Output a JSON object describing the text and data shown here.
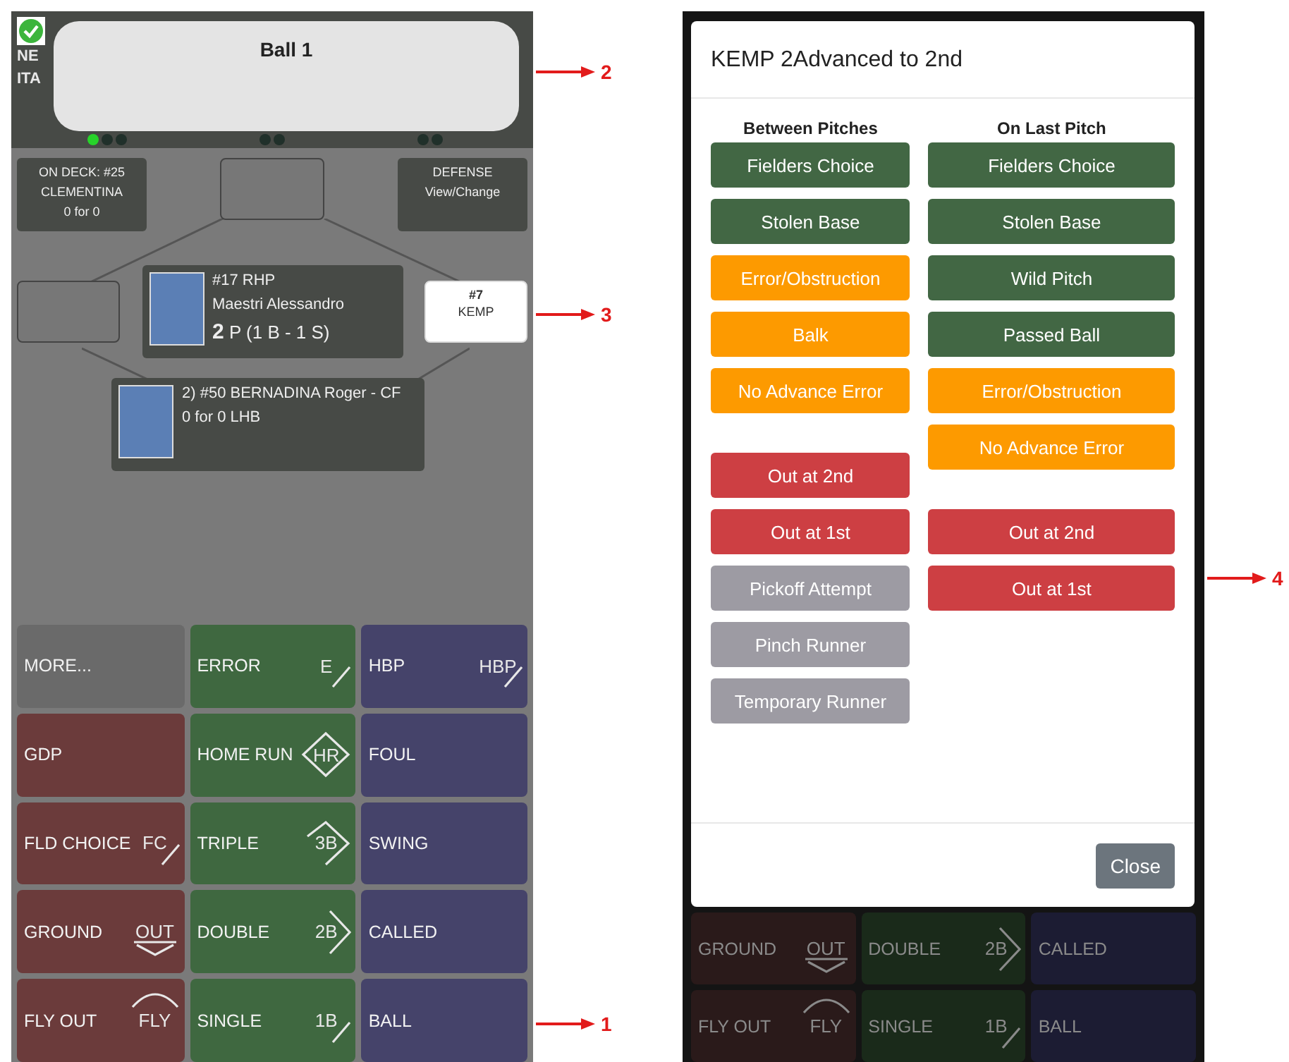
{
  "left_screen": {
    "scoreboard": {
      "saved": true,
      "teams": [
        "NE",
        "ITA"
      ],
      "balls": [
        {
          "lit": true
        },
        {
          "lit": false
        },
        {
          "lit": false
        }
      ],
      "strikes": [
        {
          "lit": false
        },
        {
          "lit": false
        }
      ],
      "outs": [
        {
          "lit": false
        },
        {
          "lit": false
        }
      ]
    },
    "toast": {
      "title": "Ball 1"
    },
    "field": {
      "on_deck": {
        "lines": [
          "ON DECK: #25",
          "CLEMENTINA",
          "0 for 0"
        ]
      },
      "defense": {
        "lines": [
          "DEFENSE",
          "View/Change"
        ]
      },
      "second_base": {
        "occupied": false
      },
      "third_base": {
        "occupied": false
      },
      "first_base": {
        "occupied": true,
        "number": "#7",
        "name": "KEMP"
      },
      "pitcher": {
        "line1": "#17 RHP",
        "name": "Maestri Alessandro",
        "pitch_count": "2",
        "pitch_detail": "P (1 B - 1 S)"
      },
      "batter": {
        "line1": "2) #50 BERNADINA Roger - CF",
        "line2": "0 for 0 LHB"
      }
    },
    "buttons": [
      {
        "label": "MORE...",
        "kind": "more"
      },
      {
        "label": "ERROR",
        "kind": "hit",
        "symbol": {
          "text": "E",
          "kind": "slash"
        }
      },
      {
        "label": "HBP",
        "kind": "pitch",
        "symbol": {
          "text": "HBP",
          "kind": "slash"
        }
      },
      {
        "label": "GDP",
        "kind": "out"
      },
      {
        "label": "HOME RUN",
        "kind": "hit",
        "symbol": {
          "text": "HR",
          "kind": "diamond"
        }
      },
      {
        "label": "FOUL",
        "kind": "pitch"
      },
      {
        "label": "FLD CHOICE",
        "kind": "out",
        "symbol": {
          "text": "FC",
          "kind": "slash"
        }
      },
      {
        "label": "TRIPLE",
        "kind": "hit",
        "symbol": {
          "text": "3B",
          "kind": "triple"
        }
      },
      {
        "label": "SWING",
        "kind": "pitch"
      },
      {
        "label": "GROUND",
        "kind": "out",
        "symbol": {
          "text": "OUT",
          "kind": "catch"
        }
      },
      {
        "label": "DOUBLE",
        "kind": "hit",
        "symbol": {
          "text": "2B",
          "kind": "chevron"
        }
      },
      {
        "label": "CALLED",
        "kind": "pitch"
      },
      {
        "label": "FLY OUT",
        "kind": "out",
        "symbol": {
          "text": "FLY",
          "kind": "arc"
        }
      },
      {
        "label": "SINGLE",
        "kind": "hit",
        "symbol": {
          "text": "1B",
          "kind": "slash"
        }
      },
      {
        "label": "BALL",
        "kind": "pitch"
      }
    ]
  },
  "right_screen": {
    "modal": {
      "title": "KEMP 2Advanced to 2nd",
      "columns": [
        {
          "heading": "Between Pitches",
          "groups": [
            [
              {
                "label": "Fielders Choice",
                "kind": "advance"
              },
              {
                "label": "Stolen Base",
                "kind": "advance"
              },
              {
                "label": "Error/Obstruction",
                "kind": "error"
              },
              {
                "label": "Balk",
                "kind": "error"
              },
              {
                "label": "No Advance Error",
                "kind": "error"
              }
            ],
            [
              {
                "label": "Out at 2nd",
                "kind": "out"
              },
              {
                "label": "Out at 1st",
                "kind": "out"
              },
              {
                "label": "Pickoff Attempt",
                "kind": "other"
              },
              {
                "label": "Pinch Runner",
                "kind": "other"
              },
              {
                "label": "Temporary Runner",
                "kind": "other"
              }
            ]
          ]
        },
        {
          "heading": "On Last Pitch",
          "groups": [
            [
              {
                "label": "Fielders Choice",
                "kind": "advance"
              },
              {
                "label": "Stolen Base",
                "kind": "advance"
              },
              {
                "label": "Wild Pitch",
                "kind": "advance"
              },
              {
                "label": "Passed Ball",
                "kind": "advance"
              },
              {
                "label": "Error/Obstruction",
                "kind": "error"
              },
              {
                "label": "No Advance Error",
                "kind": "error"
              }
            ],
            [
              {
                "label": "Out at 2nd",
                "kind": "out"
              },
              {
                "label": "Out at 1st",
                "kind": "out"
              }
            ]
          ]
        }
      ],
      "close": "Close"
    },
    "background_buttons": [
      {
        "label": "GROUND",
        "kind": "out",
        "symbol": {
          "text": "OUT",
          "kind": "catch"
        }
      },
      {
        "label": "DOUBLE",
        "kind": "hit",
        "symbol": {
          "text": "2B",
          "kind": "chevron"
        }
      },
      {
        "label": "CALLED",
        "kind": "pitch"
      },
      {
        "label": "FLY OUT",
        "kind": "out",
        "symbol": {
          "text": "FLY",
          "kind": "arc"
        }
      },
      {
        "label": "SINGLE",
        "kind": "hit",
        "symbol": {
          "text": "1B",
          "kind": "slash"
        }
      },
      {
        "label": "BALL",
        "kind": "pitch"
      }
    ]
  },
  "annotations": [
    {
      "label": "2"
    },
    {
      "label": "3"
    },
    {
      "label": "1"
    },
    {
      "label": "4"
    }
  ]
}
